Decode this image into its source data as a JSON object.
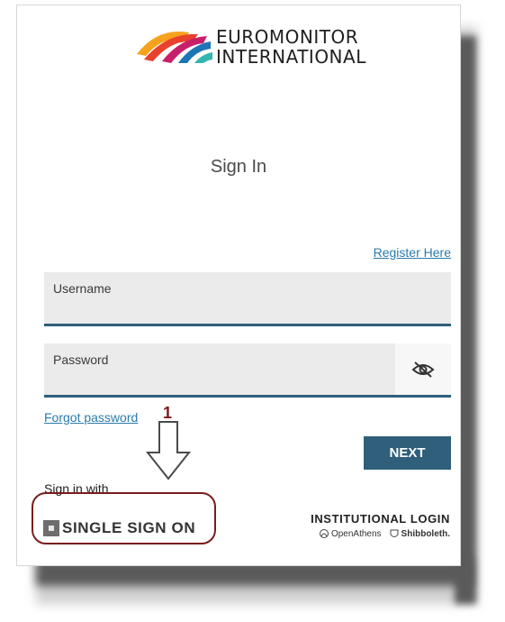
{
  "brand": {
    "name_line1": "EUROMONITOR",
    "name_line2": "INTERNATIONAL",
    "colors": [
      "#f6a21c",
      "#e8412c",
      "#c81f6a",
      "#1d74b7",
      "#35b6b0"
    ]
  },
  "signin": {
    "title": "Sign In",
    "register_link": "Register Here",
    "username_label": "Username",
    "password_label": "Password",
    "password_toggle_icon": "eye-slash-icon",
    "forgot_link": "Forgot password",
    "next_label": "NEXT",
    "sign_in_with": "Sign in with",
    "sso_label": "SINGLE SIGN ON",
    "institutional_title": "INSTITUTIONAL LOGIN",
    "providers": [
      "OpenAthens",
      "Shibboleth."
    ]
  },
  "annotation": {
    "number": "1",
    "color": "#7a1c1c"
  },
  "colors": {
    "accent": "#2f5f7a",
    "link": "#2b7bab"
  }
}
